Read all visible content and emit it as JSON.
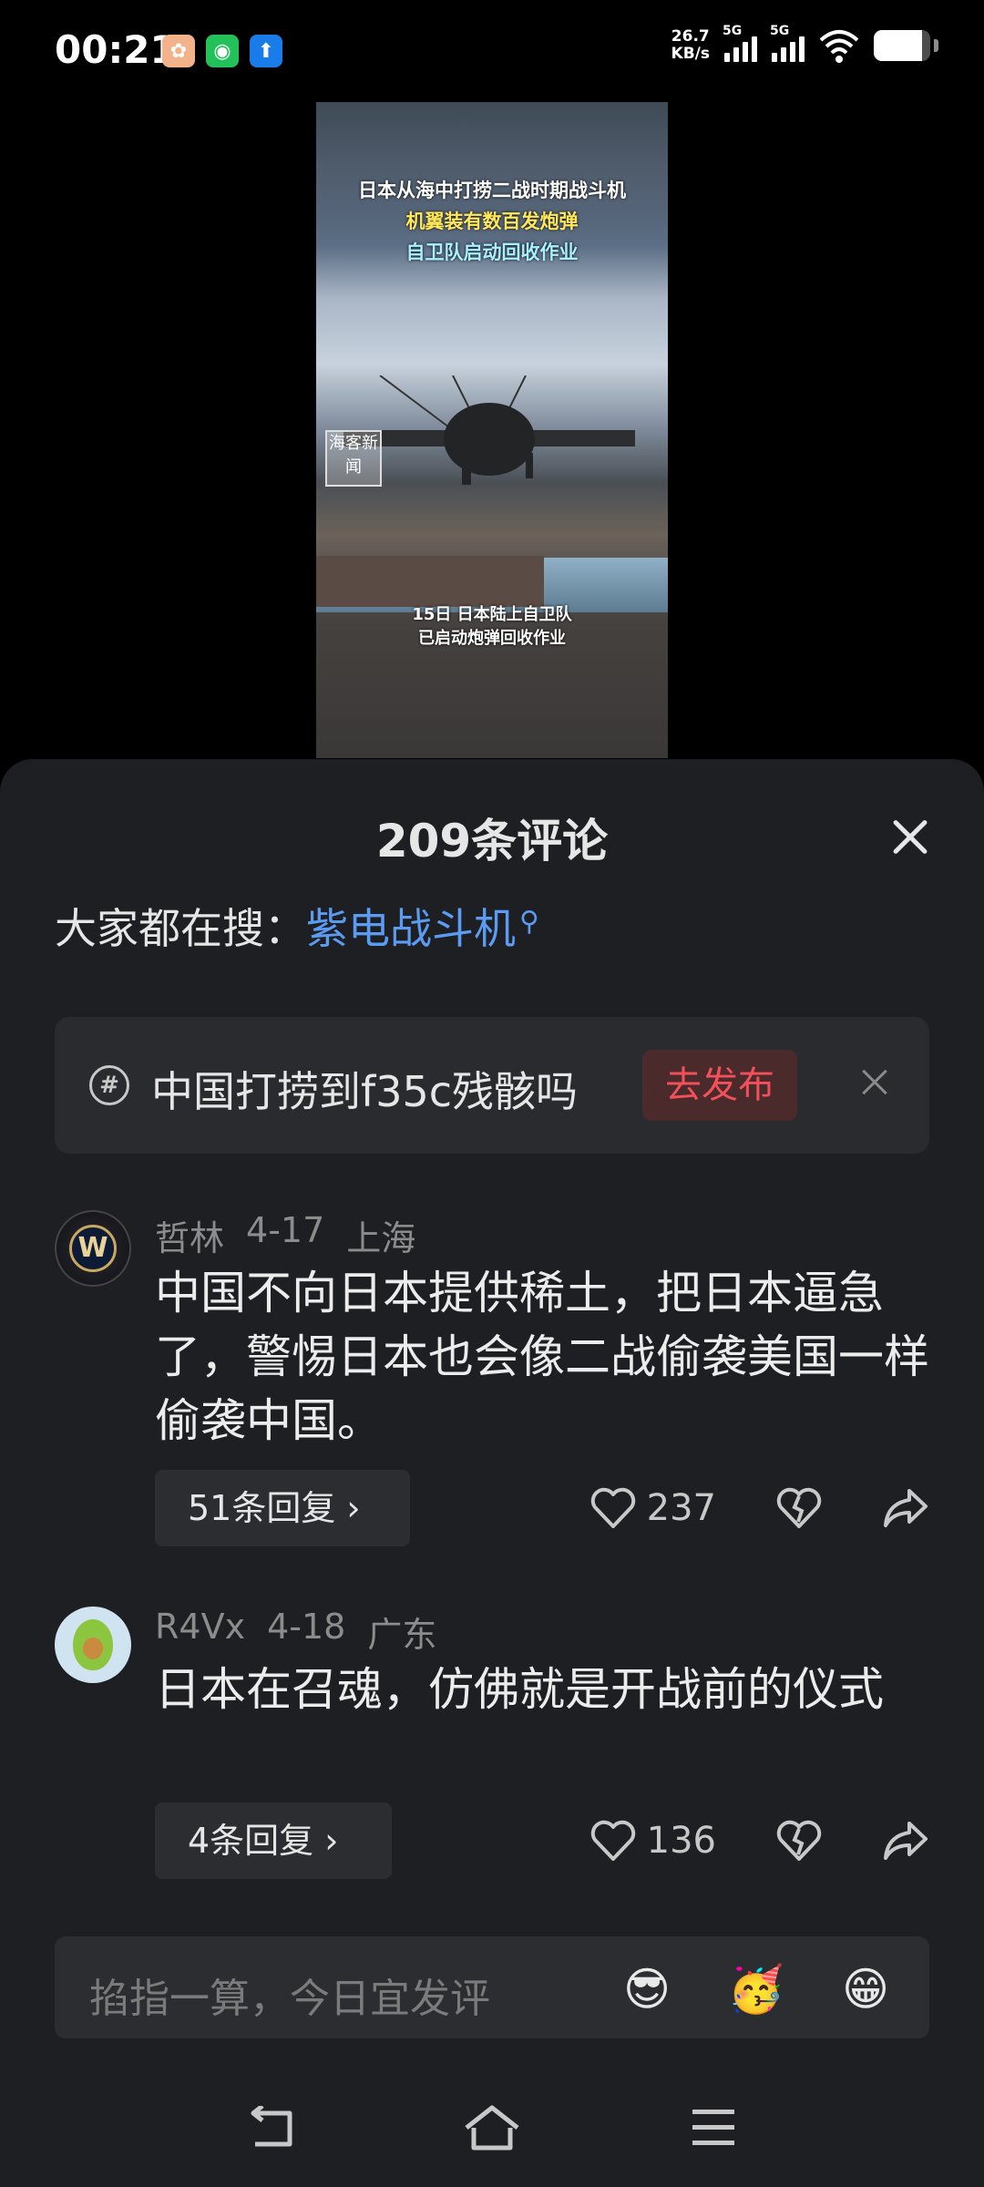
{
  "status_bar": {
    "time": "00:21",
    "net_speed_value": "26.7",
    "net_speed_unit": "KB/s",
    "signal1_label": "5G",
    "signal2_label": "5G",
    "battery_level": 0.85
  },
  "video": {
    "title_line1": "日本从海中打捞二战时期战斗机",
    "title_line2": "机翼装有数百发炮弹",
    "title_line3": "自卫队启动回收作业",
    "watermark": "海客新闻",
    "caption_line1": "15日 日本陆上自卫队",
    "caption_line2": "已启动炮弹回收作业"
  },
  "panel": {
    "title": "209条评论",
    "search_prefix": "大家都在搜：",
    "search_term": "紫电战斗机"
  },
  "prompt_card": {
    "text": "中国打捞到f35c残骸吗",
    "button": "去发布"
  },
  "comments": [
    {
      "username": "哲林",
      "date": "4-17",
      "location": "上海",
      "text": "中国不向日本提供稀土，把日本逼急了，警惕日本也会像二战偷袭美国一样偷袭中国。",
      "replies": "51条回复 ›",
      "likes": "237",
      "avatar_letter": "W"
    },
    {
      "username": "R4Vx",
      "date": "4-18",
      "location": "广东",
      "text": "日本在召魂，仿佛就是开战前的仪式",
      "replies": "4条回复 ›",
      "likes": "136"
    }
  ],
  "input_bar": {
    "placeholder": "掐指一算，今日宜发评",
    "emojis": [
      "😎",
      "🥳",
      "😁"
    ]
  },
  "icons": {
    "close": "close-icon",
    "like": "heart-icon",
    "dislike": "broken-heart-icon",
    "share": "share-icon",
    "nav_back": "back-icon",
    "nav_home": "home-icon",
    "nav_menu": "menu-icon"
  },
  "colors": {
    "panel_bg": "#1e1f22",
    "link": "#5b9bf2",
    "publish": "#f2505a"
  }
}
